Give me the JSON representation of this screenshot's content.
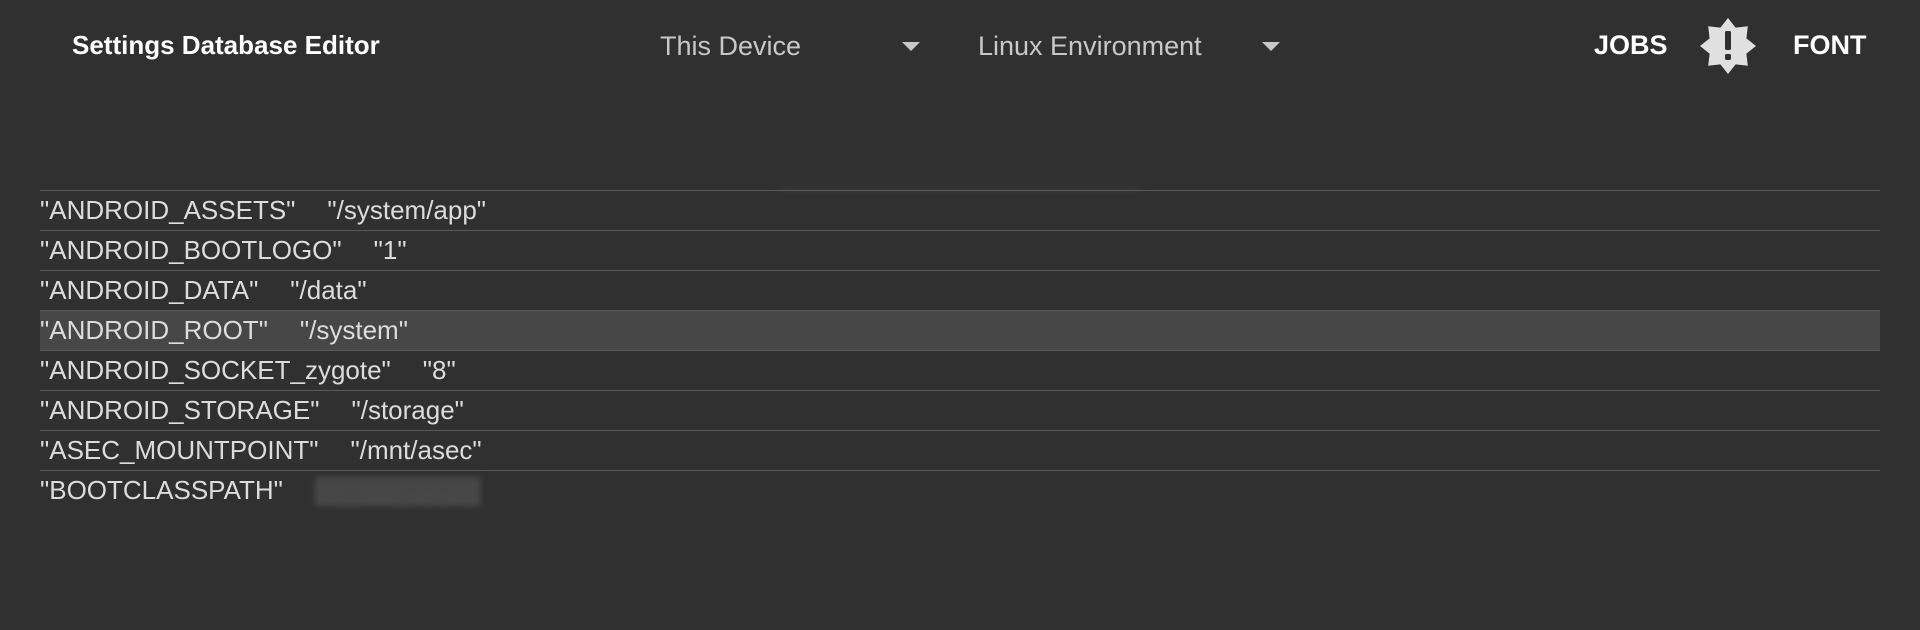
{
  "app": {
    "title": "Settings Database Editor"
  },
  "toolbar": {
    "device_selector": {
      "selected": "This Device",
      "icon": "arrow-drop-down-icon"
    },
    "environment_selector": {
      "selected": "Linux Environment",
      "icon": "arrow-drop-down-icon"
    },
    "jobs_label": "JOBS",
    "alert_icon": "alert-badge-icon",
    "font_label": "FONT"
  },
  "env_list": {
    "rows": [
      {
        "key": "\"ANDROID_ASSETS\"",
        "value": "\"/system/app\""
      },
      {
        "key": "\"ANDROID_BOOTLOGO\"",
        "value": "\"1\""
      },
      {
        "key": "\"ANDROID_DATA\"",
        "value": "\"/data\""
      },
      {
        "key": "\"ANDROID_ROOT\"",
        "value": "\"/system\"",
        "selected": true
      },
      {
        "key": "\"ANDROID_SOCKET_zygote\"",
        "value": "\"8\""
      },
      {
        "key": "\"ANDROID_STORAGE\"",
        "value": "\"/storage\""
      },
      {
        "key": "\"ASEC_MOUNTPOINT\"",
        "value": "\"/mnt/asec\""
      },
      {
        "key": "\"BOOTCLASSPATH\"",
        "value": ""
      }
    ]
  },
  "colors": {
    "background": "#303030",
    "row_selected": "#474747",
    "divider": "#5a5a5a",
    "alert_badge": "#e0e0e0"
  }
}
